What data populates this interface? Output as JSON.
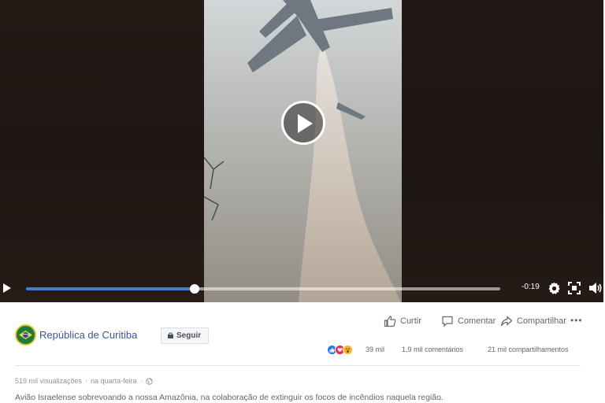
{
  "player": {
    "time_remaining": "-0:19",
    "progress": 0.355
  },
  "post": {
    "page_name": "República de Curitiba",
    "follow_label": "Seguir",
    "actions": {
      "like": "Curtir",
      "comment": "Comentar",
      "share": "Compartilhar"
    },
    "stats": {
      "reactions": "39 mil",
      "comments": "1,9 mil comentários",
      "shares": "21 mil compartilhamentos"
    },
    "views": "519 mil visualizações",
    "separator": "·",
    "posted": "na quarta-feira",
    "caption": "Avião Israelense sobrevoando a nossa Amazônia, na colaboração de extinguir os focos de incêndios naquela região."
  },
  "colors": {
    "progress": "#4a76d8",
    "link": "#385898",
    "like": "#2078f4",
    "love": "#f0284a",
    "wow": "#f7b125"
  }
}
